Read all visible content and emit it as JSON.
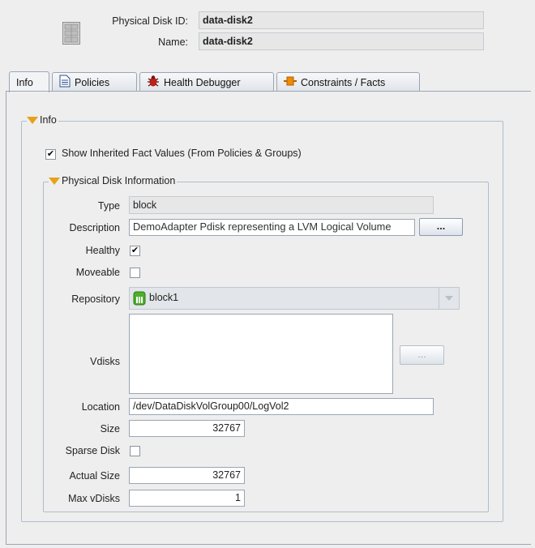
{
  "header": {
    "disk_id_label": "Physical Disk ID:",
    "disk_id_value": "data-disk2",
    "name_label": "Name:",
    "name_value": "data-disk2"
  },
  "tabs": [
    {
      "label": "Info",
      "icon": "none",
      "active": true
    },
    {
      "label": "Policies",
      "icon": "document-icon"
    },
    {
      "label": "Health Debugger",
      "icon": "bug-icon"
    },
    {
      "label": "Constraints / Facts",
      "icon": "constraint-icon"
    }
  ],
  "info_section": {
    "title": "Info",
    "show_inherited_label": "Show Inherited Fact Values (From Policies & Groups)",
    "show_inherited_checked": true
  },
  "disk_info": {
    "title": "Physical Disk Information",
    "type_label": "Type",
    "type_value": "block",
    "description_label": "Description",
    "description_value": "DemoAdapter Pdisk representing a LVM Logical Volume",
    "description_button": "...",
    "healthy_label": "Healthy",
    "healthy_checked": true,
    "moveable_label": "Moveable",
    "moveable_checked": false,
    "repository_label": "Repository",
    "repository_value": "block1",
    "vdisks_label": "Vdisks",
    "vdisks_button": "...",
    "location_label": "Location",
    "location_value": "/dev/DataDiskVolGroup00/LogVol2",
    "size_label": "Size",
    "size_value": "32767",
    "sparse_label": "Sparse Disk",
    "sparse_checked": false,
    "actual_size_label": "Actual Size",
    "actual_size_value": "32767",
    "max_vdisks_label": "Max vDisks",
    "max_vdisks_value": "1"
  },
  "colors": {
    "accent_triangle": "#e5a21a",
    "repository_icon": "#4caf2a",
    "bug_icon": "#c0201a",
    "constraint_icon": "#f08a00"
  }
}
